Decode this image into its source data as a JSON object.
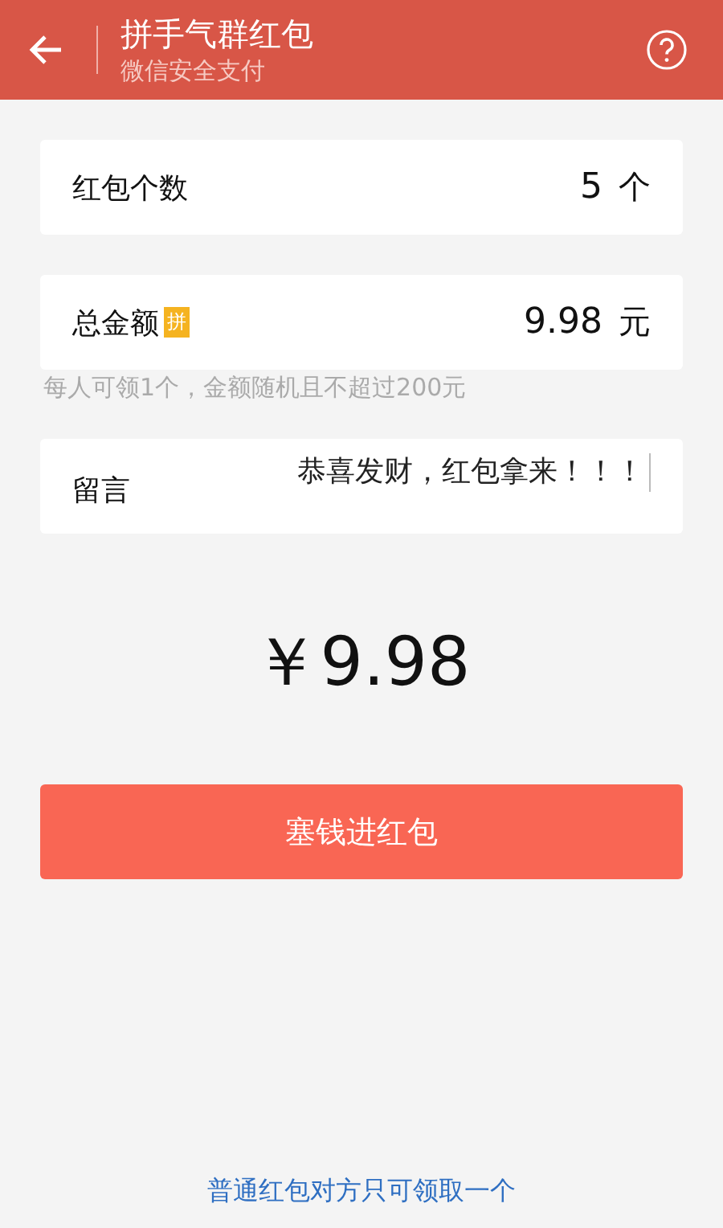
{
  "header": {
    "title": "拼手气群红包",
    "subtitle": "微信安全支付"
  },
  "count": {
    "label": "红包个数",
    "value": "5",
    "unit": "个"
  },
  "total": {
    "label": "总金额",
    "badge": "拼",
    "value": "9.98",
    "unit": "元",
    "hint": "每人可领1个，金额随机且不超过200元"
  },
  "message": {
    "label": "留言",
    "value": "恭喜发财，红包拿来！！！"
  },
  "amount": "￥9.98",
  "submit": "塞钱进红包",
  "switch_link": "普通红包对方只可领取一个"
}
